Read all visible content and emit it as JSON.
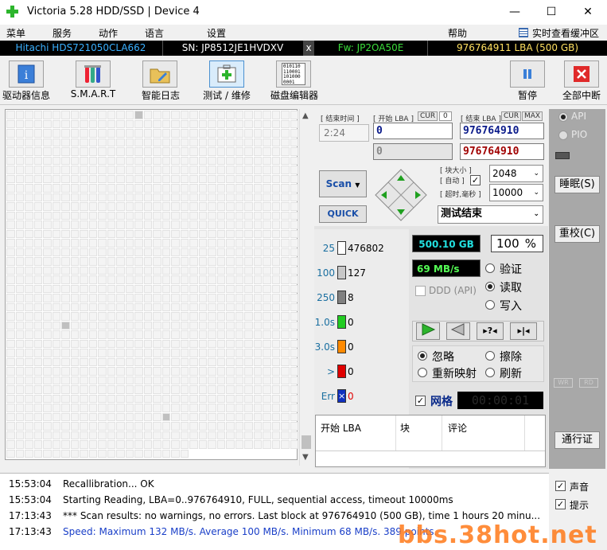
{
  "window": {
    "title": "Victoria 5.28 HDD/SSD | Device 4",
    "minimize": "—",
    "maximize": "☐",
    "close": "✕"
  },
  "menu": {
    "items": [
      "菜单",
      "服务",
      "动作",
      "语言",
      "设置",
      "帮助"
    ],
    "right_label": "实时查看缓冲区"
  },
  "info": {
    "model": "Hitachi HDS721050CLA662",
    "serial": "SN: JP8512JE1HVDXV",
    "close_mark": "x",
    "firmware": "Fw: JP2OA50E",
    "capacity": "976764911 LBA (500 GB)"
  },
  "toolbar": {
    "buttons": [
      "驱动器信息",
      "S.M.A.R.T",
      "智能日志",
      "测试 / 维修",
      "磁盘编辑器"
    ],
    "pause": "暂停",
    "abort": "全部中断",
    "hex_icon_text": "010110 110001 101000 0001"
  },
  "test": {
    "timer_label": "[ 结束时间 ]",
    "timer_value": "2:24",
    "start_lba_label": "[ 开始 LBA ]",
    "cur1": "CUR",
    "cur1_value": "0",
    "end_lba_label": "[ 结束 LBA ]",
    "cur2": "CUR",
    "max": "MAX",
    "start_lba": "0",
    "end_lba": "976764910",
    "start_lba2": "0",
    "end_lba2": "976764910",
    "block_size_label": "[ 块大小 ]",
    "auto_label": "[ 自动 ]",
    "timeout_label": "[ 超时,毫秒 ]",
    "block_size": "2048",
    "timeout": "10000",
    "scan": "Scan",
    "quick": "QUICK",
    "status": "测试结束"
  },
  "counts": [
    {
      "label": "25",
      "value": "476802",
      "color": "#ffffff"
    },
    {
      "label": "100",
      "value": "127",
      "color": "#c8c8c8"
    },
    {
      "label": "250",
      "value": "8",
      "color": "#808080"
    },
    {
      "label": "1.0s",
      "value": "0",
      "color": "#22cc22"
    },
    {
      "label": "3.0s",
      "value": "0",
      "color": "#ff8a00"
    },
    {
      "label": ">",
      "value": "0",
      "color": "#e00000"
    },
    {
      "label": "Err",
      "value": "0",
      "color": "#1030c0"
    }
  ],
  "stats": {
    "size": "500.10 GB",
    "percent": "100",
    "percent_unit": "%",
    "speed": "69 MB/s",
    "ddd": "DDD (API)"
  },
  "mode": {
    "verify": "验证",
    "read": "读取",
    "write": "写入",
    "selected": "read"
  },
  "action": {
    "ignore": "忽略",
    "erase": "擦除",
    "remap": "重新映射",
    "refresh": "刷新",
    "selected": "ignore"
  },
  "grid_check": {
    "label": "网格",
    "timer": "00:00:01"
  },
  "table": {
    "headers": [
      "开始 LBA",
      "块",
      "评论"
    ]
  },
  "side": {
    "api": "API",
    "pio": "PIO",
    "sleep": "睡眠(S)",
    "recal": "重校(C)",
    "wr": "WR",
    "rd": "RD",
    "passport": "通行证"
  },
  "log": [
    {
      "time": "15:53:04",
      "text": "Recallibration... OK",
      "color": "#000000"
    },
    {
      "time": "15:53:04",
      "text": "Starting Reading, LBA=0..976764910, FULL, sequential access, timeout 10000ms",
      "color": "#000000"
    },
    {
      "time": "17:13:43",
      "text": "*** Scan results: no warnings, no errors. Last block at 976764910 (500 GB), time 1 hours 20 minu...",
      "color": "#000000"
    },
    {
      "time": "17:13:43",
      "text": "Speed: Maximum 132 MB/s. Average 100 MB/s. Minimum 68 MB/s. 389 points.",
      "color": "#1a3fc8"
    }
  ],
  "log_side": {
    "sound": "声音",
    "hint": "提示"
  },
  "watermark": "bbs.38hot.net",
  "colors": {
    "accent_green": "#2cb52c",
    "field_blue": "#0a1a8a",
    "field_red": "#a00000",
    "stat_bg": "#000000",
    "stat_cyan": "#22e0e0",
    "stat_green": "#55ff55"
  }
}
